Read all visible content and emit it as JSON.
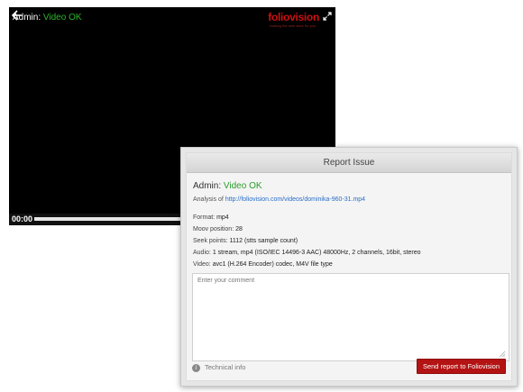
{
  "player": {
    "admin_label": "Admin:",
    "status_text": "Video OK",
    "logo_text": "foliovision",
    "logo_tagline": "making the web work for you",
    "time": "00:00"
  },
  "dialog": {
    "title": "Report Issue",
    "admin_label": "Admin:",
    "status_text": "Video OK",
    "analysis_prefix": "Analysis of",
    "analysis_url": "http://foliovision.com/videos/dominika-960-31.mp4",
    "info": {
      "format_label": "Format:",
      "format_value": "mp4",
      "moov_label": "Moov position:",
      "moov_value": "28",
      "seek_label": "Seek points:",
      "seek_value": "1112 (stts sample count)",
      "audio_label": "Audio:",
      "audio_value": "1 stream, mp4 (ISO/IEC 14496-3 AAC) 48000Hz, 2 channels, 16bit, stereo",
      "video_label": "Video:",
      "video_value": "avc1 (H.264 Encoder) codec, M4V file type"
    },
    "comment_placeholder": "Enter your comment",
    "technical_info_label": "Technical info",
    "send_label": "Send report to Foliovision"
  },
  "colors": {
    "ok_green": "#29b629",
    "brand_red": "#cc1111",
    "button_red": "#b31313",
    "link_blue": "#2a6fc9"
  },
  "icons": [
    "back-arrow-icon",
    "fullscreen-icon",
    "resize-grip-icon",
    "info-icon"
  ]
}
